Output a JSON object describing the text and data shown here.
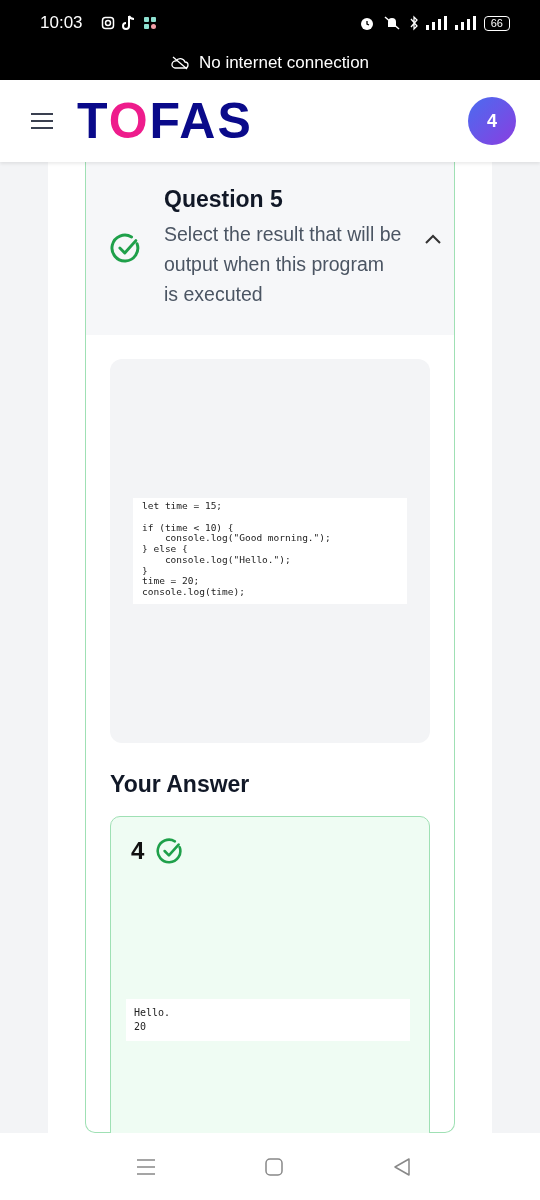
{
  "status_bar": {
    "time": "10:03",
    "battery": "66",
    "notice": "No internet connection"
  },
  "header": {
    "logo": [
      {
        "text": "T",
        "color": "#0a0a8a"
      },
      {
        "text": "O",
        "color": "#ee1c8c"
      },
      {
        "text": "FAS",
        "color": "#0a0a8a"
      }
    ],
    "badge": "4"
  },
  "question": {
    "title": "Question 5",
    "text": "Select the result that will be output when this program is executed",
    "correct": true,
    "expanded": true,
    "code": "let time = 15;\n\nif (time < 10) {\n    console.log(\"Good morning.\");\n} else {\n    console.log(\"Hello.\");\n}\ntime = 20;\nconsole.log(time);"
  },
  "answer": {
    "heading": "Your Answer",
    "number": "4",
    "correct": true,
    "output": [
      "Hello.",
      "20"
    ]
  }
}
